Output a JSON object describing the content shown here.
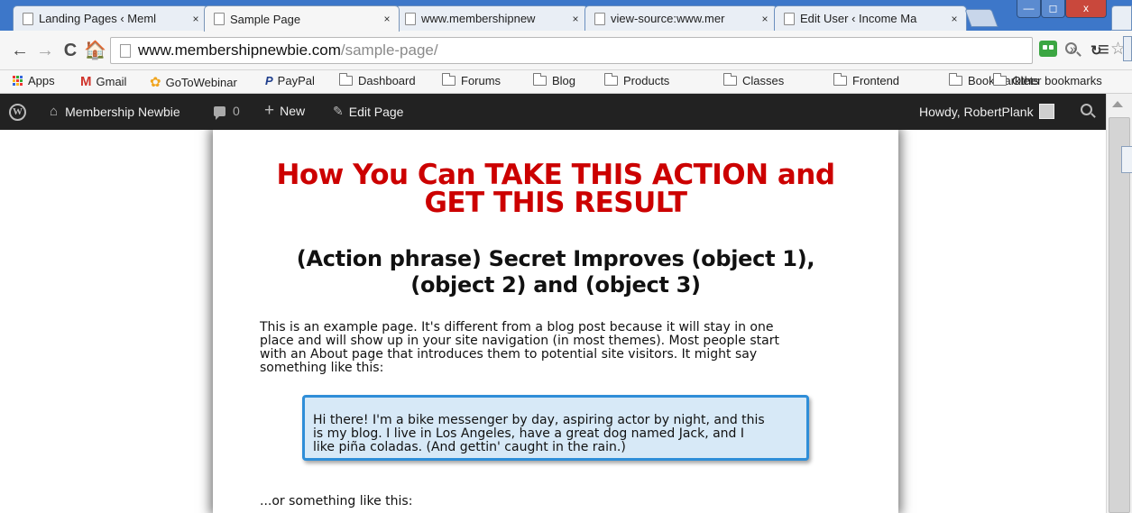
{
  "tabs": [
    {
      "title": "Landing Pages ‹ Meml",
      "close": "×"
    },
    {
      "title": "Sample Page",
      "close": "×"
    },
    {
      "title": "www.membershipnew",
      "close": "×"
    },
    {
      "title": "view-source:www.mer",
      "close": "×"
    },
    {
      "title": "Edit User ‹ Income Ma",
      "close": "×"
    }
  ],
  "window": {
    "minimize": "—",
    "maximize": "◻",
    "close": "x"
  },
  "toolbar": {
    "back": "←",
    "forward": "→",
    "reload": "C",
    "home": "🏠",
    "url_host": "www.membershipnewbie.com",
    "url_path": "/sample-page/",
    "overflow": "»",
    "menu": "≡"
  },
  "bookmarks": {
    "apps": "Apps",
    "gmail": "Gmail",
    "gotowebinar": "GoToWebinar",
    "paypal": "PayPal",
    "folders": [
      "Dashboard",
      "Forums",
      "Blog",
      "Products",
      "Classes",
      "Frontend",
      "Bookmarklets"
    ],
    "other": "Other bookmarks"
  },
  "adminbar": {
    "site_name": "Membership Newbie",
    "comment_count": "0",
    "new_label": "New",
    "edit_label": "Edit Page",
    "howdy": "Howdy, RobertPlank"
  },
  "page": {
    "headline_line1": "How You Can TAKE THIS ACTION and",
    "headline_line2": "GET THIS RESULT",
    "subheadline_line1": "(Action phrase) Secret Improves (object 1),",
    "subheadline_line2": "(object 2) and (object 3)",
    "intro_lines": [
      "This is an example page. It's different from a blog post because it will stay in one",
      "place and will show up in your site navigation (in most themes). Most people start",
      "with an About page that introduces them to potential site visitors. It might say",
      "something like this:"
    ],
    "quote_lines": [
      "Hi there! I'm a bike messenger by day, aspiring actor by night, and this",
      "is my blog. I live in Los Angeles, have a great dog named Jack, and I",
      "like piña coladas. (And gettin' caught in the rain.)"
    ],
    "outro": "...or something like this:"
  },
  "colors": {
    "headline": "#cc0000",
    "quote_border": "#2f8ed8",
    "quote_bg": "#d7e9f7",
    "adminbar": "#222222"
  }
}
